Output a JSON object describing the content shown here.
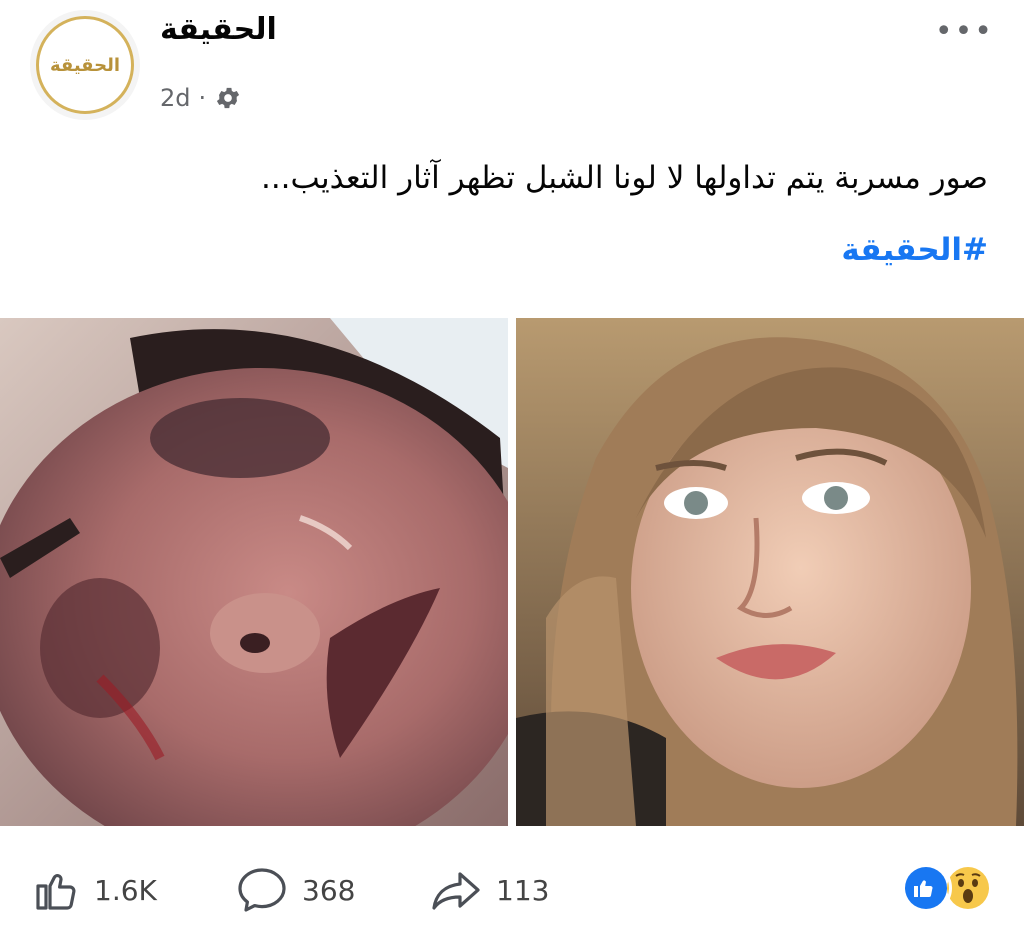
{
  "post": {
    "page_name": "الحقيقة",
    "avatar_text": "الحقيقة",
    "time": "2d",
    "separator": "·",
    "privacy_icon": "gear-icon",
    "more_icon": "more-icon",
    "more_label": "•••",
    "text": "صور مسربة يتم تداولها  لا لونا الشبل تظهر آثار التعذيب...",
    "hashtag": "#الحقيقة"
  },
  "photos": [
    {
      "name": "photo-injured-face"
    },
    {
      "name": "photo-woman-portrait"
    }
  ],
  "footer": {
    "likes": "1.6K",
    "comments": "368",
    "shares": "113"
  },
  "colors": {
    "link": "#1877f2",
    "gold": "#d4b25b",
    "muted": "#65676b"
  }
}
